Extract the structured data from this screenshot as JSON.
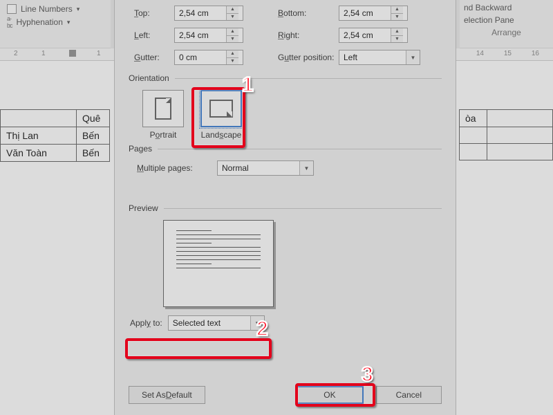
{
  "ribbon_left": {
    "line_numbers": "Line Numbers",
    "hyphenation": "Hyphenation"
  },
  "ribbon_right": {
    "backward": "nd Backward",
    "selection_pane": "election Pane",
    "arrange": "Arrange"
  },
  "ruler_left": [
    "2",
    "1",
    "",
    "1"
  ],
  "ruler_right": [
    "14",
    "15",
    "16"
  ],
  "doc_rows": {
    "hdr2": "Quê",
    "r1c1": "Thị Lan",
    "r1c2": "Bến",
    "r2c1": "Văn Toàn",
    "r2c2": "Bến",
    "right_hdr": "òa"
  },
  "margins": {
    "top_lbl": "Top:",
    "top_val": "2,54 cm",
    "bottom_lbl": "Bottom:",
    "bottom_val": "2,54 cm",
    "left_lbl": "Left:",
    "left_val": "2,54 cm",
    "right_lbl": "Right:",
    "right_val": "2,54 cm",
    "gutter_lbl": "Gutter:",
    "gutter_val": "0 cm",
    "gutter_pos_lbl": "Gutter position:",
    "gutter_pos_val": "Left"
  },
  "orientation": {
    "header": "Orientation",
    "portrait": "Portrait",
    "landscape": "Landscape"
  },
  "pages": {
    "header": "Pages",
    "multiple_lbl": "Multiple pages:",
    "multiple_val": "Normal"
  },
  "preview": {
    "header": "Preview"
  },
  "apply_to": {
    "label": "Apply to:",
    "value": "Selected text"
  },
  "buttons": {
    "default": "Set As Default",
    "ok": "OK",
    "cancel": "Cancel"
  },
  "callouts": {
    "n1": "1",
    "n2": "2",
    "n3": "3"
  }
}
